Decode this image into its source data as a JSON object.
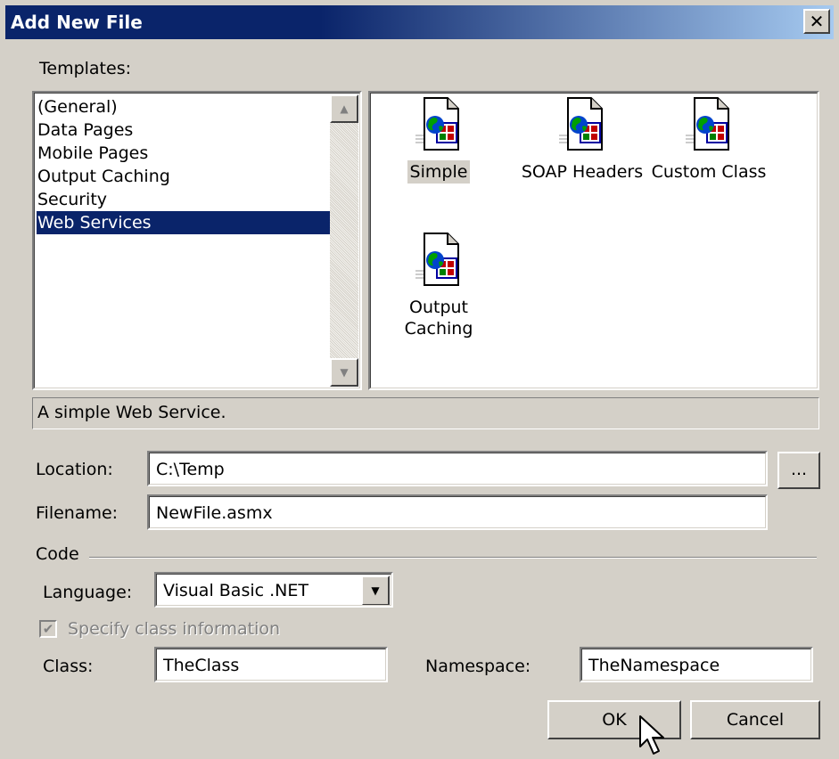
{
  "window": {
    "title": "Add New File",
    "close_glyph": "✕"
  },
  "templates_label": "Templates:",
  "categories": [
    {
      "label": "(General)",
      "selected": false
    },
    {
      "label": "Data Pages",
      "selected": false
    },
    {
      "label": "Mobile Pages",
      "selected": false
    },
    {
      "label": "Output Caching",
      "selected": false
    },
    {
      "label": "Security",
      "selected": false
    },
    {
      "label": "Web Services",
      "selected": true
    }
  ],
  "scroll": {
    "up_glyph": "▲",
    "down_glyph": "▼"
  },
  "templates": [
    {
      "label": "Simple",
      "selected": true,
      "icon": "web-service-file-icon"
    },
    {
      "label": "SOAP Headers",
      "selected": false,
      "icon": "web-service-file-icon"
    },
    {
      "label": "Custom Class",
      "selected": false,
      "icon": "web-service-file-icon"
    },
    {
      "label": "Output Caching",
      "selected": false,
      "icon": "web-service-file-icon"
    }
  ],
  "description": "A simple Web Service.",
  "location": {
    "label": "Location:",
    "value": "C:\\Temp",
    "browse_label": "..."
  },
  "filename": {
    "label": "Filename:",
    "value": "NewFile.asmx"
  },
  "code": {
    "group_label": "Code",
    "language_label": "Language:",
    "language_value": "Visual Basic .NET",
    "dropdown_glyph": "▼",
    "specify_label": "Specify class information",
    "specify_checked": true,
    "check_glyph": "✔",
    "class_label": "Class:",
    "class_value": "TheClass",
    "namespace_label": "Namespace:",
    "namespace_value": "TheNamespace"
  },
  "buttons": {
    "ok": "OK",
    "cancel": "Cancel"
  },
  "colors": {
    "titlebar_start": "#0a246a",
    "titlebar_end": "#a6caf0",
    "selection": "#0a246a",
    "window_bg": "#d4d0c8"
  }
}
